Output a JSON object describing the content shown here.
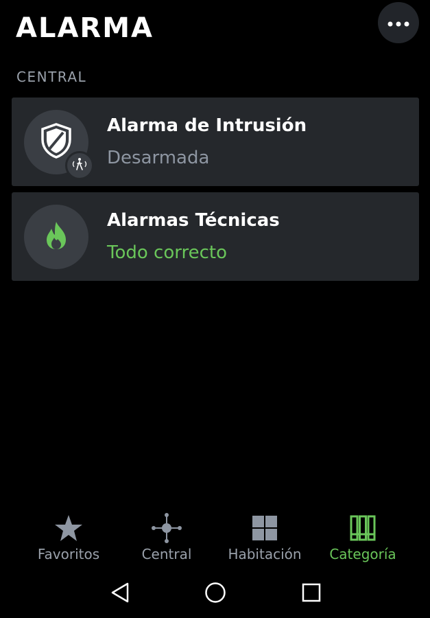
{
  "header": {
    "title": "ALARMA",
    "more_icon": "more-horizontal-icon"
  },
  "section": {
    "label": "CENTRAL"
  },
  "cards": [
    {
      "title": "Alarma de Intrusión",
      "status": "Desarmada",
      "status_color": "#8e96a2",
      "icon": "shield-icon",
      "badge_icon": "motion-sensor-icon"
    },
    {
      "title": "Alarmas Técnicas",
      "status": "Todo correcto",
      "status_color": "#6ac65a",
      "icon": "flame-icon"
    }
  ],
  "bottom_nav": {
    "items": [
      {
        "label": "Favoritos",
        "icon": "star-icon",
        "active": false
      },
      {
        "label": "Central",
        "icon": "hub-icon",
        "active": false
      },
      {
        "label": "Habitación",
        "icon": "grid-icon",
        "active": false
      },
      {
        "label": "Categoría",
        "icon": "category-icon",
        "active": true
      }
    ],
    "active_color": "#6ac65a",
    "inactive_color": "#9aa1ab"
  },
  "system_nav": {
    "back_icon": "back-triangle-icon",
    "home_icon": "home-circle-icon",
    "recents_icon": "recents-square-icon"
  }
}
